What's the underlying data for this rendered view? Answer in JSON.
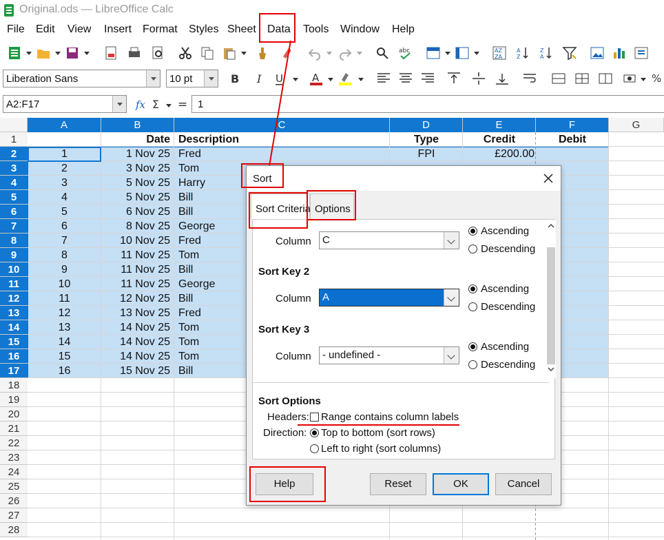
{
  "window": {
    "title": "Original.ods — LibreOffice Calc"
  },
  "menu": [
    "File",
    "Edit",
    "View",
    "Insert",
    "Format",
    "Styles",
    "Sheet",
    "Data",
    "Tools",
    "Window",
    "Help"
  ],
  "toolbar": {
    "font_name": "Liberation Sans",
    "font_size": "10 pt"
  },
  "formula_bar": {
    "name_box": "A2:F17",
    "content": "1"
  },
  "columns": [
    "A",
    "B",
    "C",
    "D",
    "E",
    "F",
    "G"
  ],
  "header_row": {
    "row": "1",
    "B": "Date",
    "C": "Description",
    "D": "Type",
    "E": "Credit",
    "F": "Debit"
  },
  "rows": [
    {
      "row": "2",
      "A": "1",
      "B": "1 Nov 25",
      "C": "Fred",
      "D": "FPI",
      "E": "£200.00"
    },
    {
      "row": "3",
      "A": "2",
      "B": "3 Nov 25",
      "C": "Tom",
      "D": "",
      "E": ""
    },
    {
      "row": "4",
      "A": "3",
      "B": "5 Nov 25",
      "C": "Harry",
      "D": "",
      "E": ""
    },
    {
      "row": "5",
      "A": "4",
      "B": "5 Nov 25",
      "C": "Bill",
      "D": "",
      "E": ""
    },
    {
      "row": "6",
      "A": "5",
      "B": "6 Nov 25",
      "C": "Bill",
      "D": "",
      "E": ""
    },
    {
      "row": "7",
      "A": "6",
      "B": "8 Nov 25",
      "C": "George",
      "D": "",
      "E": ""
    },
    {
      "row": "8",
      "A": "7",
      "B": "10 Nov 25",
      "C": "Fred",
      "D": "",
      "E": ""
    },
    {
      "row": "9",
      "A": "8",
      "B": "11 Nov 25",
      "C": "Tom",
      "D": "",
      "E": ""
    },
    {
      "row": "10",
      "A": "9",
      "B": "11 Nov 25",
      "C": "Bill",
      "D": "",
      "E": ""
    },
    {
      "row": "11",
      "A": "10",
      "B": "11 Nov 25",
      "C": "George",
      "D": "",
      "E": ""
    },
    {
      "row": "12",
      "A": "11",
      "B": "12 Nov 25",
      "C": "Bill",
      "D": "",
      "E": ""
    },
    {
      "row": "13",
      "A": "12",
      "B": "13 Nov 25",
      "C": "Fred",
      "D": "",
      "E": ""
    },
    {
      "row": "14",
      "A": "13",
      "B": "14 Nov 25",
      "C": "Tom",
      "D": "",
      "E": ""
    },
    {
      "row": "15",
      "A": "14",
      "B": "14 Nov 25",
      "C": "Tom",
      "D": "",
      "E": ""
    },
    {
      "row": "16",
      "A": "15",
      "B": "14 Nov 25",
      "C": "Tom",
      "D": "",
      "E": ""
    },
    {
      "row": "17",
      "A": "16",
      "B": "15 Nov 25",
      "C": "Bill",
      "D": "",
      "E": ""
    }
  ],
  "empty_rows": [
    "18",
    "19",
    "20",
    "21",
    "22",
    "23",
    "24",
    "25",
    "26",
    "27",
    "28"
  ],
  "dialog": {
    "title": "Sort",
    "tabs": [
      "Sort Criteria",
      "Options"
    ],
    "key1": {
      "column_label": "Column",
      "value": "C"
    },
    "key2": {
      "heading": "Sort Key 2",
      "column_label": "Column",
      "value": "A"
    },
    "key3": {
      "heading": "Sort Key 3",
      "column_label": "Column",
      "value": "- undefined -"
    },
    "ascending": "Ascending",
    "descending": "Descending",
    "options_heading": "Sort Options",
    "headers_label": "Headers:",
    "headers_checkbox": "Range contains column labels",
    "direction_label": "Direction:",
    "dir_top": "Top to bottom (sort rows)",
    "dir_left": "Left to right (sort columns)",
    "buttons": {
      "help": "Help",
      "reset": "Reset",
      "ok": "OK",
      "cancel": "Cancel"
    }
  },
  "colors": {
    "selection": "#c5dff5",
    "header_selected": "#1177d1",
    "annotation": "#e30000"
  }
}
